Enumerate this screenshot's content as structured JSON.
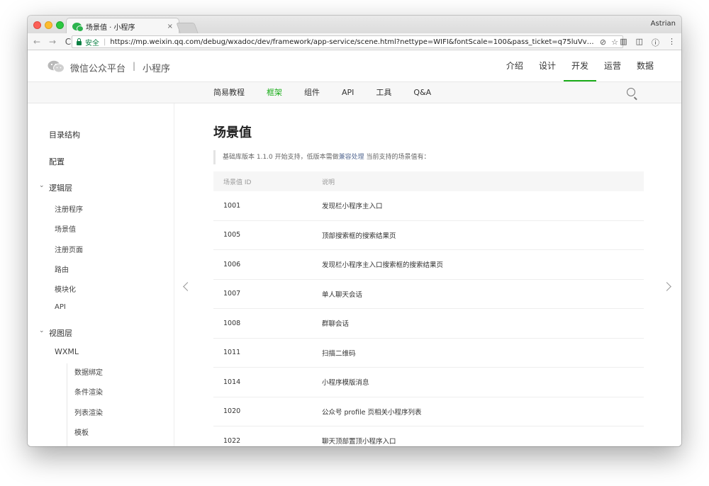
{
  "browser": {
    "tab_title": "场景值 · 小程序",
    "tab_close": "×",
    "profile_name": "Astrian",
    "secure_label": "安全",
    "url_sep": "|",
    "url": "https://mp.weixin.qq.com/debug/wxadoc/dev/framework/app-service/scene.html?nettype=WIFI&fontScale=100&pass_ticket=q75luVv97gVh3bW9lcyax...",
    "nav": {
      "back": "←",
      "forward": "→",
      "reload": "C"
    },
    "omni_icons": [
      "⊘",
      "☆"
    ],
    "ext_icons": [
      "▥",
      "◫",
      "ⓘ",
      "⋮"
    ]
  },
  "header": {
    "logo_text": "微信公众平台",
    "divider": "|",
    "logo_sub": "小程序",
    "nav": [
      "介绍",
      "设计",
      "开发",
      "运营",
      "数据"
    ],
    "active_nav": "开发"
  },
  "subnav": {
    "items": [
      "简易教程",
      "框架",
      "组件",
      "API",
      "工具",
      "Q&A"
    ],
    "active": "框架"
  },
  "sidebar": {
    "catalog": "目录结构",
    "config": "配置",
    "logic_layer": "逻辑层",
    "logic_items": [
      "注册程序",
      "场景值",
      "注册页面",
      "路由",
      "模块化",
      "API"
    ],
    "view_layer": "视图层",
    "wxml": "WXML",
    "wxml_items": [
      "数据绑定",
      "条件渲染",
      "列表渲染",
      "模板"
    ],
    "chevron": "⌄"
  },
  "page": {
    "title": "场景值",
    "notice_prefix": "基础库版本 1.1.0 开始支持，低版本需做",
    "notice_link": "兼容处理",
    "notice_suffix": " 当前支持的场景值有：",
    "table": {
      "headers": [
        "场景值 ID",
        "说明"
      ],
      "rows": [
        [
          "1001",
          "发现栏小程序主入口"
        ],
        [
          "1005",
          "顶部搜索框的搜索结果页"
        ],
        [
          "1006",
          "发现栏小程序主入口搜索框的搜索结果页"
        ],
        [
          "1007",
          "单人聊天会话"
        ],
        [
          "1008",
          "群聊会话"
        ],
        [
          "1011",
          "扫描二维码"
        ],
        [
          "1014",
          "小程序模版消息"
        ],
        [
          "1020",
          "公众号 profile 页相关小程序列表"
        ],
        [
          "1022",
          "聊天顶部置顶小程序入口"
        ]
      ]
    }
  },
  "colors": {
    "accent": "#1aad19",
    "link": "#586c94"
  }
}
